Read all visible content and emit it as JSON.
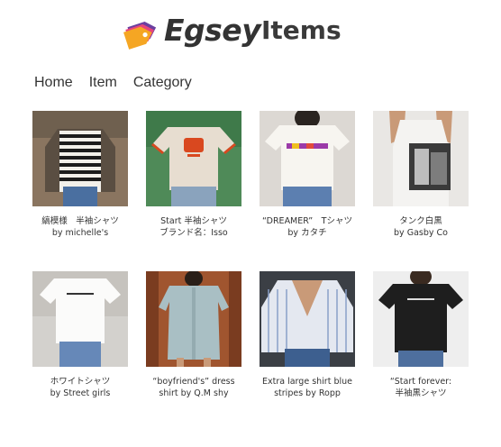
{
  "brand": {
    "logo_text": "Egsey",
    "page_title": "Items"
  },
  "nav": {
    "items": [
      "Home",
      "Item",
      "Category"
    ]
  },
  "items": [
    {
      "line1": "縞模様　半袖シャツ",
      "line2": "by michelle's"
    },
    {
      "line1": "Start 半袖シャツ",
      "line2": "ブランド名：Isso"
    },
    {
      "line1": "“DREAMER”　Tシャツ",
      "line2": "by カタチ"
    },
    {
      "line1": "タンク白黒",
      "line2": "by Gasby Co"
    },
    {
      "line1": "ホワイトシャツ",
      "line2": "by Street girls"
    },
    {
      "line1": "“boyfriend's” dress",
      "line2": "shirt by Q.M shy"
    },
    {
      "line1": "Extra large shirt blue",
      "line2": "stripes by Ropp"
    },
    {
      "line1": "“Start forever:",
      "line2": "半袖黒シャツ"
    }
  ],
  "colors": {
    "logo_orange": "#f5a623",
    "logo_pink": "#e8457a",
    "logo_purple": "#6b3fa0",
    "text": "#333333"
  }
}
